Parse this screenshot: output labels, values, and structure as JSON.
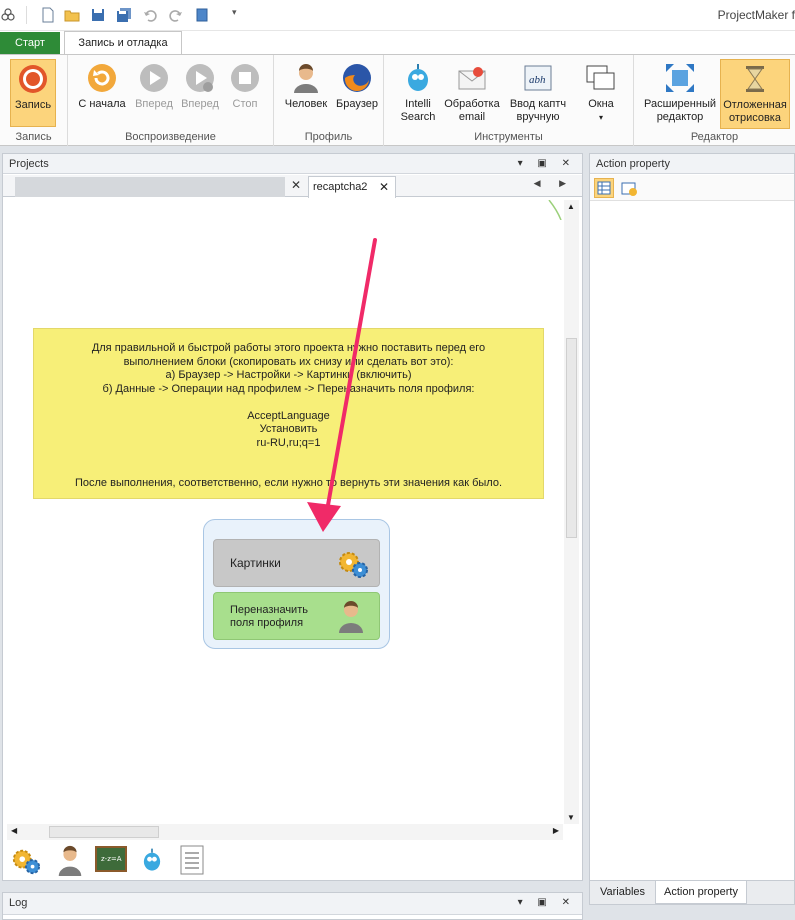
{
  "app": {
    "title": "ProjectMaker f"
  },
  "ribbon_tabs": {
    "start": "Старт",
    "record_debug": "Запись и отладка"
  },
  "ribbon": {
    "groups": {
      "record": "Запись",
      "playback": "Воспроизведение",
      "profile": "Профиль",
      "tools": "Инструменты",
      "editor": "Редактор"
    },
    "buttons": {
      "record": "Запись",
      "from_start": "С начала",
      "forward1": "Вперед",
      "forward2": "Вперед",
      "stop": "Стоп",
      "human": "Человек",
      "browser": "Браузер",
      "intelli1": "Intelli",
      "intelli2": "Search",
      "email1": "Обработка",
      "email2": "email",
      "captcha1": "Ввод каптч",
      "captcha2": "вручную",
      "windows": "Окна",
      "adv1": "Расширенный",
      "adv2": "редактор",
      "delayed1": "Отложенная",
      "delayed2": "отрисовка"
    }
  },
  "projects_panel": {
    "title": "Projects",
    "doc_tab": "recaptcha2",
    "note_lines": [
      "Для правильной и быстрой работы этого проекта нужно поставить перед его",
      "выполнением блоки (скопировать их снизу или сделать вот это):",
      "а) Браузер -> Настройки -> Картинки (включить)",
      "б) Данные -> Операции над профилем -> Переназначить поля профиля:",
      "",
      "AcceptLanguage",
      "Установить",
      "ru-RU,ru;q=1",
      "",
      "",
      "После выполнения, соответственно, если нужно то вернуть эти значения как было."
    ],
    "blocks": {
      "images": "Картинки",
      "reassign1": "Переназначить",
      "reassign2": "поля профиля"
    }
  },
  "action_panel": {
    "title": "Action property",
    "tab_variables": "Variables",
    "tab_action": "Action property"
  },
  "log_panel": {
    "title": "Log"
  },
  "colors": {
    "start_tab": "#2e8b37",
    "note_bg": "#f7ef78",
    "arrow": "#f02a68",
    "block_green": "#a8df8d",
    "pressed": "#fcd47c"
  }
}
